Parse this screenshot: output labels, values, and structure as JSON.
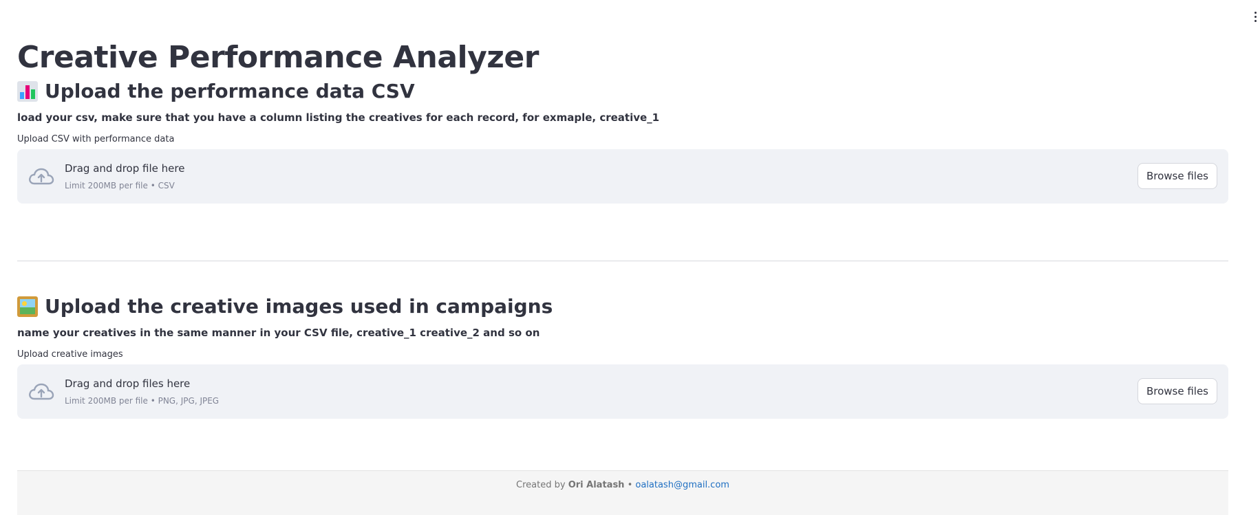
{
  "app": {
    "title": "Creative Performance Analyzer",
    "menu_icon": "vertical-ellipsis-icon"
  },
  "sections": [
    {
      "icon": "bar-chart-icon",
      "heading": "Upload the performance data CSV",
      "description": "load your csv, make sure that you have a column listing the creatives for each record, for exmaple, creative_1",
      "uploader_label": "Upload CSV with performance data",
      "dropzone_title": "Drag and drop file here",
      "dropzone_limit": "Limit 200MB per file • CSV",
      "browse_label": "Browse files"
    },
    {
      "icon": "framed-picture-icon",
      "heading": "Upload the creative images used in campaigns",
      "description": "name your creatives in the same manner in your CSV file, creative_1 creative_2 and so on",
      "uploader_label": "Upload creative images",
      "dropzone_title": "Drag and drop files here",
      "dropzone_limit": "Limit 200MB per file • PNG, JPG, JPEG",
      "browse_label": "Browse files"
    }
  ],
  "footer": {
    "prefix": "Created by ",
    "author": "Ori Alatash",
    "separator": " • ",
    "email": "oalatash@gmail.com"
  },
  "colors": {
    "text": "#31333f",
    "dropzone_bg": "#f0f2f6",
    "muted": "#808495",
    "link": "#1f6fc2"
  }
}
